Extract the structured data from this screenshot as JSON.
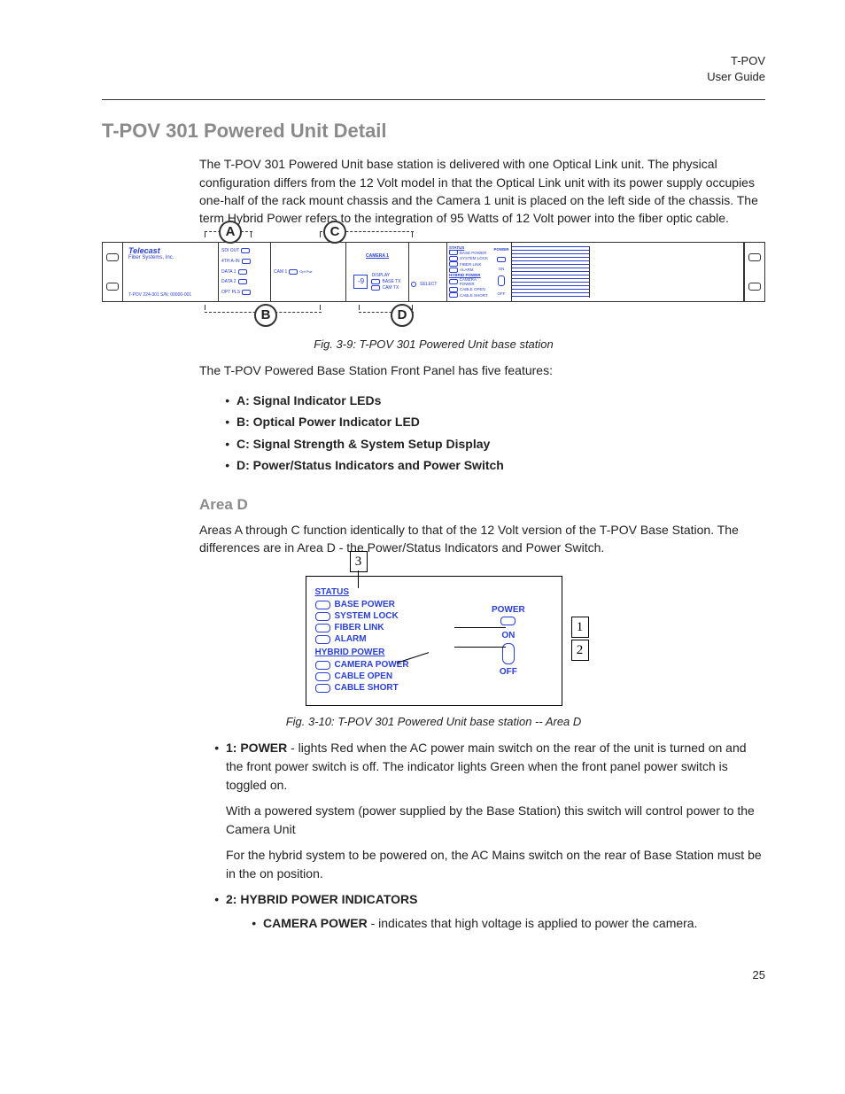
{
  "header": {
    "product": "T-POV",
    "doc": "User Guide"
  },
  "section_title": "T-POV 301 Powered Unit Detail",
  "intro": "The T-POV 301 Powered Unit base station is delivered with one Optical Link unit. The physical configuration differs from the 12 Volt model in that the Optical Link unit with its power supply occupies one-half of the rack mount chassis and the Camera 1 unit is placed on the left side of the chassis. The term Hybrid Power refers to the integration of 95 Watts of 12 Volt power into the fiber optic cable.",
  "fig1": {
    "caption": "Fig. 3-9: T-POV 301 Powered Unit base station",
    "brand": "Telecast",
    "brand_sub": "Fiber Systems, Inc.",
    "model": "T-POV 224-301 S/N: 00000-001",
    "panelA_labels": [
      "SDI OUT",
      "4TH A-IN",
      "DATA 1",
      "DATA 2",
      "OPT PLS"
    ],
    "panelB_cam": "CAM 1",
    "panelC_title": "CAMERA 1",
    "panelC_display_label": "DISPLAY",
    "panelC_display_value": "-9",
    "panelC_lines": [
      "BASE TX",
      "CAM TX"
    ],
    "panelC_select": "SELECT",
    "panelD_status": "STATUS",
    "panelD_status_items": [
      "BASE POWER",
      "SYSTEM LOCK",
      "FIBER LINK",
      "ALARM"
    ],
    "panelD_hybrid": "HYBRID POWER",
    "panelD_hybrid_items": [
      "CAMERA POWER",
      "CABLE OPEN",
      "CABLE SHORT"
    ],
    "panelD_power": "POWER",
    "panelD_on": "ON",
    "panelD_off": "OFF",
    "callouts": {
      "A": "A",
      "B": "B",
      "C": "C",
      "D": "D"
    }
  },
  "features_intro": "The T-POV Powered Base Station Front Panel has five features:",
  "features": [
    "A: Signal Indicator LEDs",
    "B: Optical Power Indicator LED",
    "C: Signal Strength & System Setup Display",
    "D: Power/Status Indicators and Power Switch"
  ],
  "areaD_heading": "Area D",
  "areaD_text": "Areas A through C function identically to that of the 12 Volt version of the T-POV Base Station. The differences are in Area D - the Power/Status Indicators and Power Switch.",
  "fig2": {
    "caption": "Fig. 3-10: T-POV 301 Powered Unit base station -- Area D",
    "status_label": "STATUS",
    "status_items": [
      "BASE POWER",
      "SYSTEM LOCK",
      "FIBER LINK",
      "ALARM"
    ],
    "hybrid_label": "HYBRID POWER",
    "hybrid_items": [
      "CAMERA POWER",
      "CABLE OPEN",
      "CABLE SHORT"
    ],
    "power_label": "POWER",
    "on": "ON",
    "off": "OFF",
    "callouts": {
      "n1": "1",
      "n2": "2",
      "n3": "3"
    }
  },
  "item1": {
    "lead": "1: POWER",
    "text1": " - lights Red when the AC power main switch on the rear of the unit is turned on and the front power switch is off. The indicator lights Green when the front panel power switch is toggled on.",
    "p2": "With a powered system (power supplied by the Base Station) this switch will control power to the Camera Unit",
    "p3": "For the hybrid system to be powered on, the AC Mains switch on the rear of Base Station must be in the on position."
  },
  "item2": {
    "lead": "2: HYBRID POWER INDICATORS",
    "sub_lead": "CAMERA POWER",
    "sub_text": " - indicates that high voltage is applied to power the camera."
  },
  "page_number": "25"
}
